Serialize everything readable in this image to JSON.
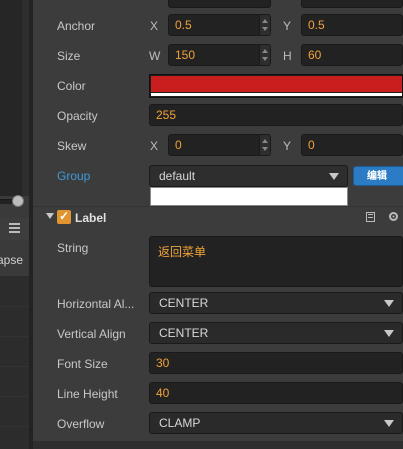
{
  "left_panel": {
    "collapse_text": "apse"
  },
  "properties": {
    "anchor": {
      "label": "Anchor",
      "x_label": "X",
      "x_value": "0.5",
      "y_label": "Y",
      "y_value": "0.5"
    },
    "size": {
      "label": "Size",
      "w_label": "W",
      "w_value": "150",
      "h_label": "H",
      "h_value": "60"
    },
    "color": {
      "label": "Color",
      "value": "#c81e1e"
    },
    "opacity": {
      "label": "Opacity",
      "value": "255"
    },
    "skew": {
      "label": "Skew",
      "x_label": "X",
      "x_value": "0",
      "y_label": "Y",
      "y_value": "0"
    },
    "group": {
      "label": "Group",
      "value": "default",
      "edit_button": "编辑"
    }
  },
  "label_component": {
    "title": "Label",
    "enabled": true,
    "string": {
      "label": "String",
      "value": "返回菜单"
    },
    "horizontal_align": {
      "label": "Horizontal Al...",
      "value": "CENTER"
    },
    "vertical_align": {
      "label": "Vertical Align",
      "value": "CENTER"
    },
    "font_size": {
      "label": "Font Size",
      "value": "30"
    },
    "line_height": {
      "label": "Line Height",
      "value": "40"
    },
    "overflow": {
      "label": "Overflow",
      "value": "CLAMP"
    }
  }
}
